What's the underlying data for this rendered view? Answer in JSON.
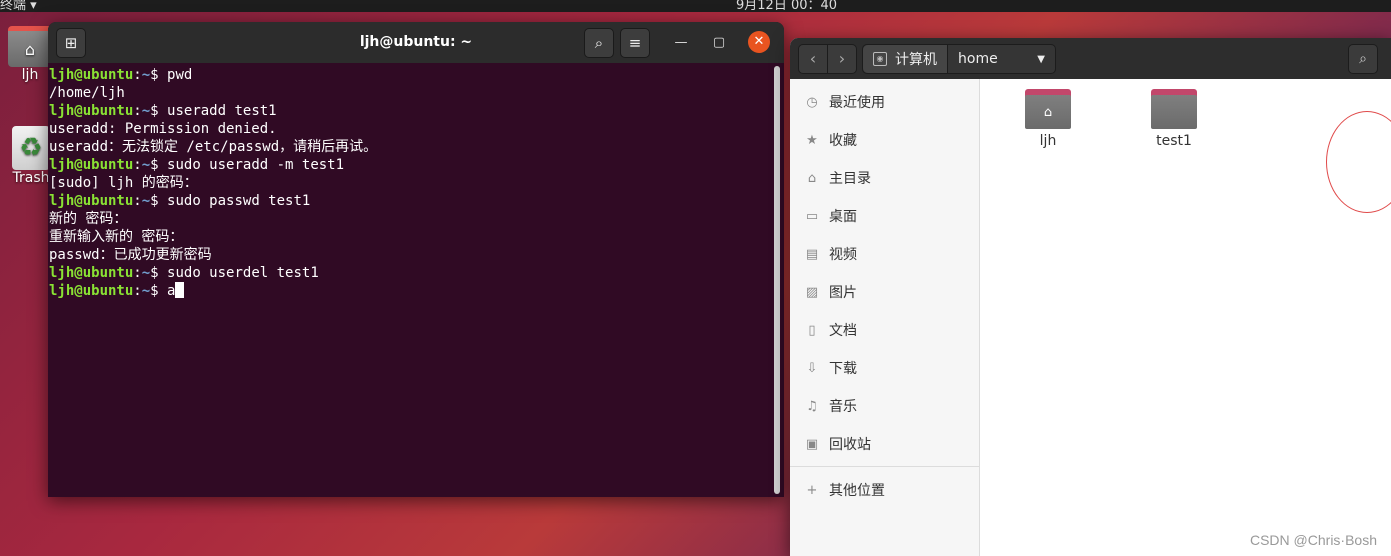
{
  "top_panel": {
    "activities": "终端 ▾",
    "clock": "9月12日 00：40"
  },
  "desktop": {
    "home_label": "ljh",
    "trash_label": "Trash"
  },
  "terminal": {
    "title": "ljh@ubuntu: ~",
    "lines": [
      {
        "prompt": true,
        "user": "ljh@ubuntu",
        "path": "~",
        "cmd": " pwd"
      },
      {
        "prompt": false,
        "text": "/home/ljh"
      },
      {
        "prompt": true,
        "user": "ljh@ubuntu",
        "path": "~",
        "cmd": " useradd test1"
      },
      {
        "prompt": false,
        "text": "useradd: Permission denied."
      },
      {
        "prompt": false,
        "text": "useradd：无法锁定 /etc/passwd，请稍后再试。"
      },
      {
        "prompt": true,
        "user": "ljh@ubuntu",
        "path": "~",
        "cmd": " sudo useradd -m test1"
      },
      {
        "prompt": false,
        "text": "[sudo] ljh 的密码："
      },
      {
        "prompt": true,
        "user": "ljh@ubuntu",
        "path": "~",
        "cmd": " sudo passwd test1"
      },
      {
        "prompt": false,
        "text": "新的 密码："
      },
      {
        "prompt": false,
        "text": "重新输入新的 密码："
      },
      {
        "prompt": false,
        "text": "passwd：已成功更新密码"
      },
      {
        "prompt": true,
        "user": "ljh@ubuntu",
        "path": "~",
        "cmd": " sudo userdel test1"
      },
      {
        "prompt": true,
        "user": "ljh@ubuntu",
        "path": "~",
        "cmd": " a",
        "cursor": true
      }
    ]
  },
  "files": {
    "path_computer": "计算机",
    "path_home": "home",
    "sidebar": [
      {
        "icon": "clock-icon",
        "glyph": "◷",
        "label": "最近使用"
      },
      {
        "icon": "star-icon",
        "glyph": "★",
        "label": "收藏"
      },
      {
        "icon": "home-icon",
        "glyph": "⌂",
        "label": "主目录"
      },
      {
        "icon": "desktop-icon",
        "glyph": "▭",
        "label": "桌面"
      },
      {
        "icon": "video-icon",
        "glyph": "▤",
        "label": "视频"
      },
      {
        "icon": "picture-icon",
        "glyph": "▨",
        "label": "图片"
      },
      {
        "icon": "document-icon",
        "glyph": "▯",
        "label": "文档"
      },
      {
        "icon": "download-icon",
        "glyph": "⇩",
        "label": "下载"
      },
      {
        "icon": "music-icon",
        "glyph": "♫",
        "label": "音乐"
      },
      {
        "icon": "trash-icon",
        "glyph": "▣",
        "label": "回收站"
      },
      {
        "icon": "plus-icon",
        "glyph": "+",
        "label": "其他位置"
      }
    ],
    "folders": [
      {
        "label": "ljh",
        "is_home": true
      },
      {
        "label": "test1",
        "is_home": false
      }
    ]
  },
  "watermark": "CSDN @Chris·Bosh"
}
